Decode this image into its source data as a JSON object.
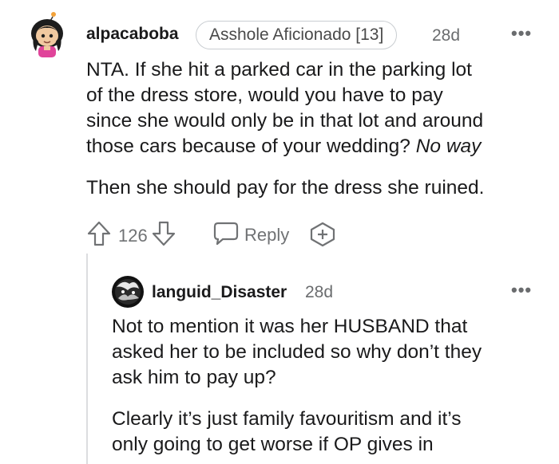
{
  "comment": {
    "username": "alpacaboba",
    "flair": "Asshole Aficionado [13]",
    "time": "28d",
    "more_icon": "•••",
    "paragraphs": [
      {
        "line1": "NTA. If she hit a parked car in the parking lot",
        "line2": "of the dress store, would you have to pay",
        "line3": "since she would only be in that lot and around",
        "line4a": "those cars because of your wedding?",
        "line4b": "No way"
      },
      {
        "line1": "Then she should pay for the dress she ruined."
      }
    ],
    "actions": {
      "upvote_icon": "arrow-up-icon",
      "score": "126",
      "downvote_icon": "arrow-down-icon",
      "reply_label": "Reply",
      "award_icon": "award-plus-icon"
    }
  },
  "reply": {
    "username": "languid_Disaster",
    "time": "28d",
    "more_icon": "•••",
    "lines": [
      "Not to mention it was her HUSBAND that",
      "asked her to be included so why don’t they",
      "ask him to pay up?",
      "Clearly it’s just family favouritism and it’s",
      "only going to get worse if OP gives in"
    ]
  }
}
